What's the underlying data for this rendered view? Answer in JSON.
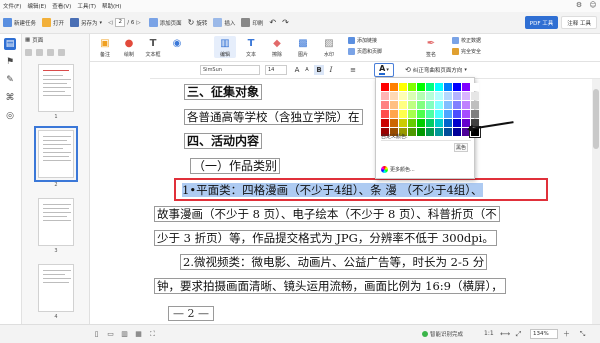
{
  "menu": [
    "文件(F)",
    "编辑(E)",
    "查看(V)",
    "工具(T)",
    "帮助(H)"
  ],
  "quickbar": {
    "new_task": "新建任务",
    "open": "打开",
    "save_as": "另存为",
    "current_page": "2",
    "total_pages": "/ 6",
    "add_page": "添加页面",
    "rotate": "旋转",
    "insert": "插入",
    "print": "印刷",
    "pdf_tool": "PDF 工具",
    "annotate_mode": "注释 工具"
  },
  "ribbon": {
    "note": "备注",
    "draw": "绘制",
    "textbox": "文本框",
    "edit": "编辑",
    "text": "文本",
    "erase": "擦除",
    "image": "图片",
    "watermark": "水印",
    "add_bookmark": "添加链接",
    "header_footer": "页眉和页脚",
    "sign": "签名",
    "proofread": "校正数据",
    "full_security": "完全安全"
  },
  "format": {
    "font": "SimSun",
    "size": "14",
    "correct_label": "纠正弯曲和页面方向"
  },
  "thumbs": {
    "header": "页面",
    "page_labels": [
      "1",
      "2",
      "3",
      "4"
    ]
  },
  "document": {
    "h_collect": "三、征集对象",
    "l_applicants": "各普通高等学校（含独立学院）在",
    "h_content": "四、活动内容",
    "h_category": "（一）作品类别",
    "l_flat": "1•平面类：四格漫画（不少于4组）、条 漫 （不少于4组）、",
    "l_story": "故事漫画（不少于 8 页）、电子绘本（不少于 8 页）、科普折页（不",
    "l_fold": "少于 3 折页）等，作品提交格式为 JPG，分辨率不低于 300dpi。",
    "l_video": "2.微视频类：微电影、动画片、公益广告等，时长为 2-5 分",
    "l_video2": "钟，要求拍摄画面清晰、镜头运用流畅，画面比例为 16:9（横屏），",
    "page_number": "— 2 —"
  },
  "color_popup": {
    "custom_label": "自定义颜色:",
    "selected_name": "黑色",
    "more_colors": "更多颜色...",
    "palette": [
      [
        "#ff0000",
        "#ff7f00",
        "#ffff00",
        "#80ff00",
        "#00ff00",
        "#00ff80",
        "#00ffff",
        "#0080ff",
        "#0000ff",
        "#8000ff",
        "#ffffff"
      ],
      [
        "#ffb3b3",
        "#ffd9b3",
        "#ffffb3",
        "#d9ffb3",
        "#b3ffb3",
        "#b3ffd9",
        "#b3ffff",
        "#b3d9ff",
        "#b3b3ff",
        "#d9b3ff",
        "#e6e6e6"
      ],
      [
        "#ff8080",
        "#ffbf80",
        "#ffff80",
        "#bfff80",
        "#80ff80",
        "#80ffbf",
        "#80ffff",
        "#80bfff",
        "#8080ff",
        "#bf80ff",
        "#bfbfbf"
      ],
      [
        "#ff4d4d",
        "#ffa64d",
        "#ffff4d",
        "#a6ff4d",
        "#4dff4d",
        "#4dffa6",
        "#4dffff",
        "#4da6ff",
        "#4d4dff",
        "#a64dff",
        "#808080"
      ],
      [
        "#cc0000",
        "#cc6600",
        "#cccc00",
        "#66cc00",
        "#00cc00",
        "#00cc66",
        "#00cccc",
        "#0066cc",
        "#0000cc",
        "#6600cc",
        "#404040"
      ],
      [
        "#990000",
        "#994d00",
        "#999900",
        "#4d9900",
        "#009900",
        "#00994d",
        "#009999",
        "#004d99",
        "#000099",
        "#4d0099",
        "#000000"
      ]
    ]
  },
  "status": {
    "ocr": "智能识别完成",
    "ratio": "1:1",
    "zoom": "134%"
  },
  "colors": {
    "accent": "#2f6fd3",
    "highlight": "#aecbf2",
    "red_box": "#e0303a"
  }
}
